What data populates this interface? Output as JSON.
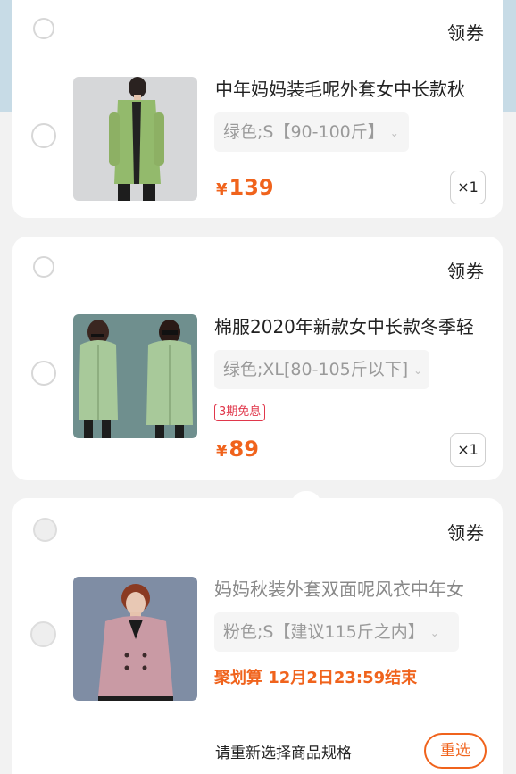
{
  "colors": {
    "price_orange": "#f0631c",
    "badge_red": "#e0374b",
    "header_blue": "#c7dbe6"
  },
  "items": [
    {
      "coupon_label": "领券",
      "title": "中年妈妈装毛呢外套女中长款秋",
      "spec": "绿色;S【90-100斤】",
      "price_symbol": "¥",
      "price": "139",
      "quantity": "×1"
    },
    {
      "coupon_label": "领券",
      "title": "棉服2020年新款女中长款冬季轻",
      "spec": "绿色;XL[80-105斤以下]",
      "installment_badge": "3期免息",
      "price_symbol": "¥",
      "price": "89",
      "quantity": "×1"
    },
    {
      "coupon_label": "领券",
      "title": "妈妈秋装外套双面呢风衣中年女",
      "spec": "粉色;S【建议115斤之内】",
      "promo": "聚划算 12月2日23:59结束",
      "reselect_hint": "请重新选择商品规格",
      "reselect_button": "重选"
    }
  ]
}
